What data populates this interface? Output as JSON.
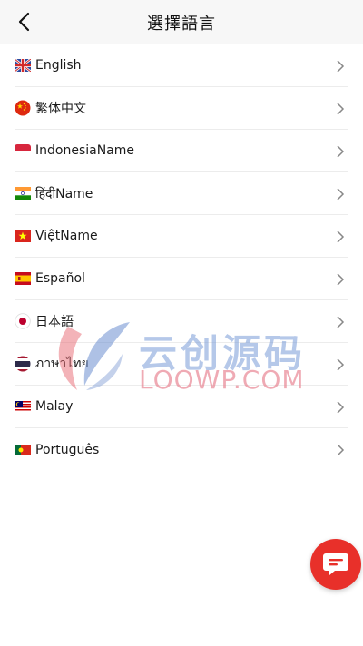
{
  "header": {
    "title": "選擇語言",
    "back_icon": "chevron-left-icon"
  },
  "languages": [
    {
      "label": "English",
      "flag": "uk-flag-icon"
    },
    {
      "label": "繁体中文",
      "flag": "china-flag-icon"
    },
    {
      "label": "IndonesiaName",
      "flag": "indonesia-flag-icon"
    },
    {
      "label": "हिंदीName",
      "flag": "india-flag-icon"
    },
    {
      "label": "ViệtName",
      "flag": "vietnam-flag-icon"
    },
    {
      "label": "Español",
      "flag": "spain-flag-icon"
    },
    {
      "label": "日本語",
      "flag": "japan-flag-icon"
    },
    {
      "label": "ภาษาไทย",
      "flag": "thailand-flag-icon"
    },
    {
      "label": "Malay",
      "flag": "malaysia-flag-icon"
    },
    {
      "label": "Português",
      "flag": "portugal-flag-icon"
    }
  ],
  "watermark": {
    "cn": "云创源码",
    "en": "LOOWP.COM"
  },
  "chat_button": {
    "icon": "chat-bubble-icon",
    "color": "#e8302a"
  }
}
